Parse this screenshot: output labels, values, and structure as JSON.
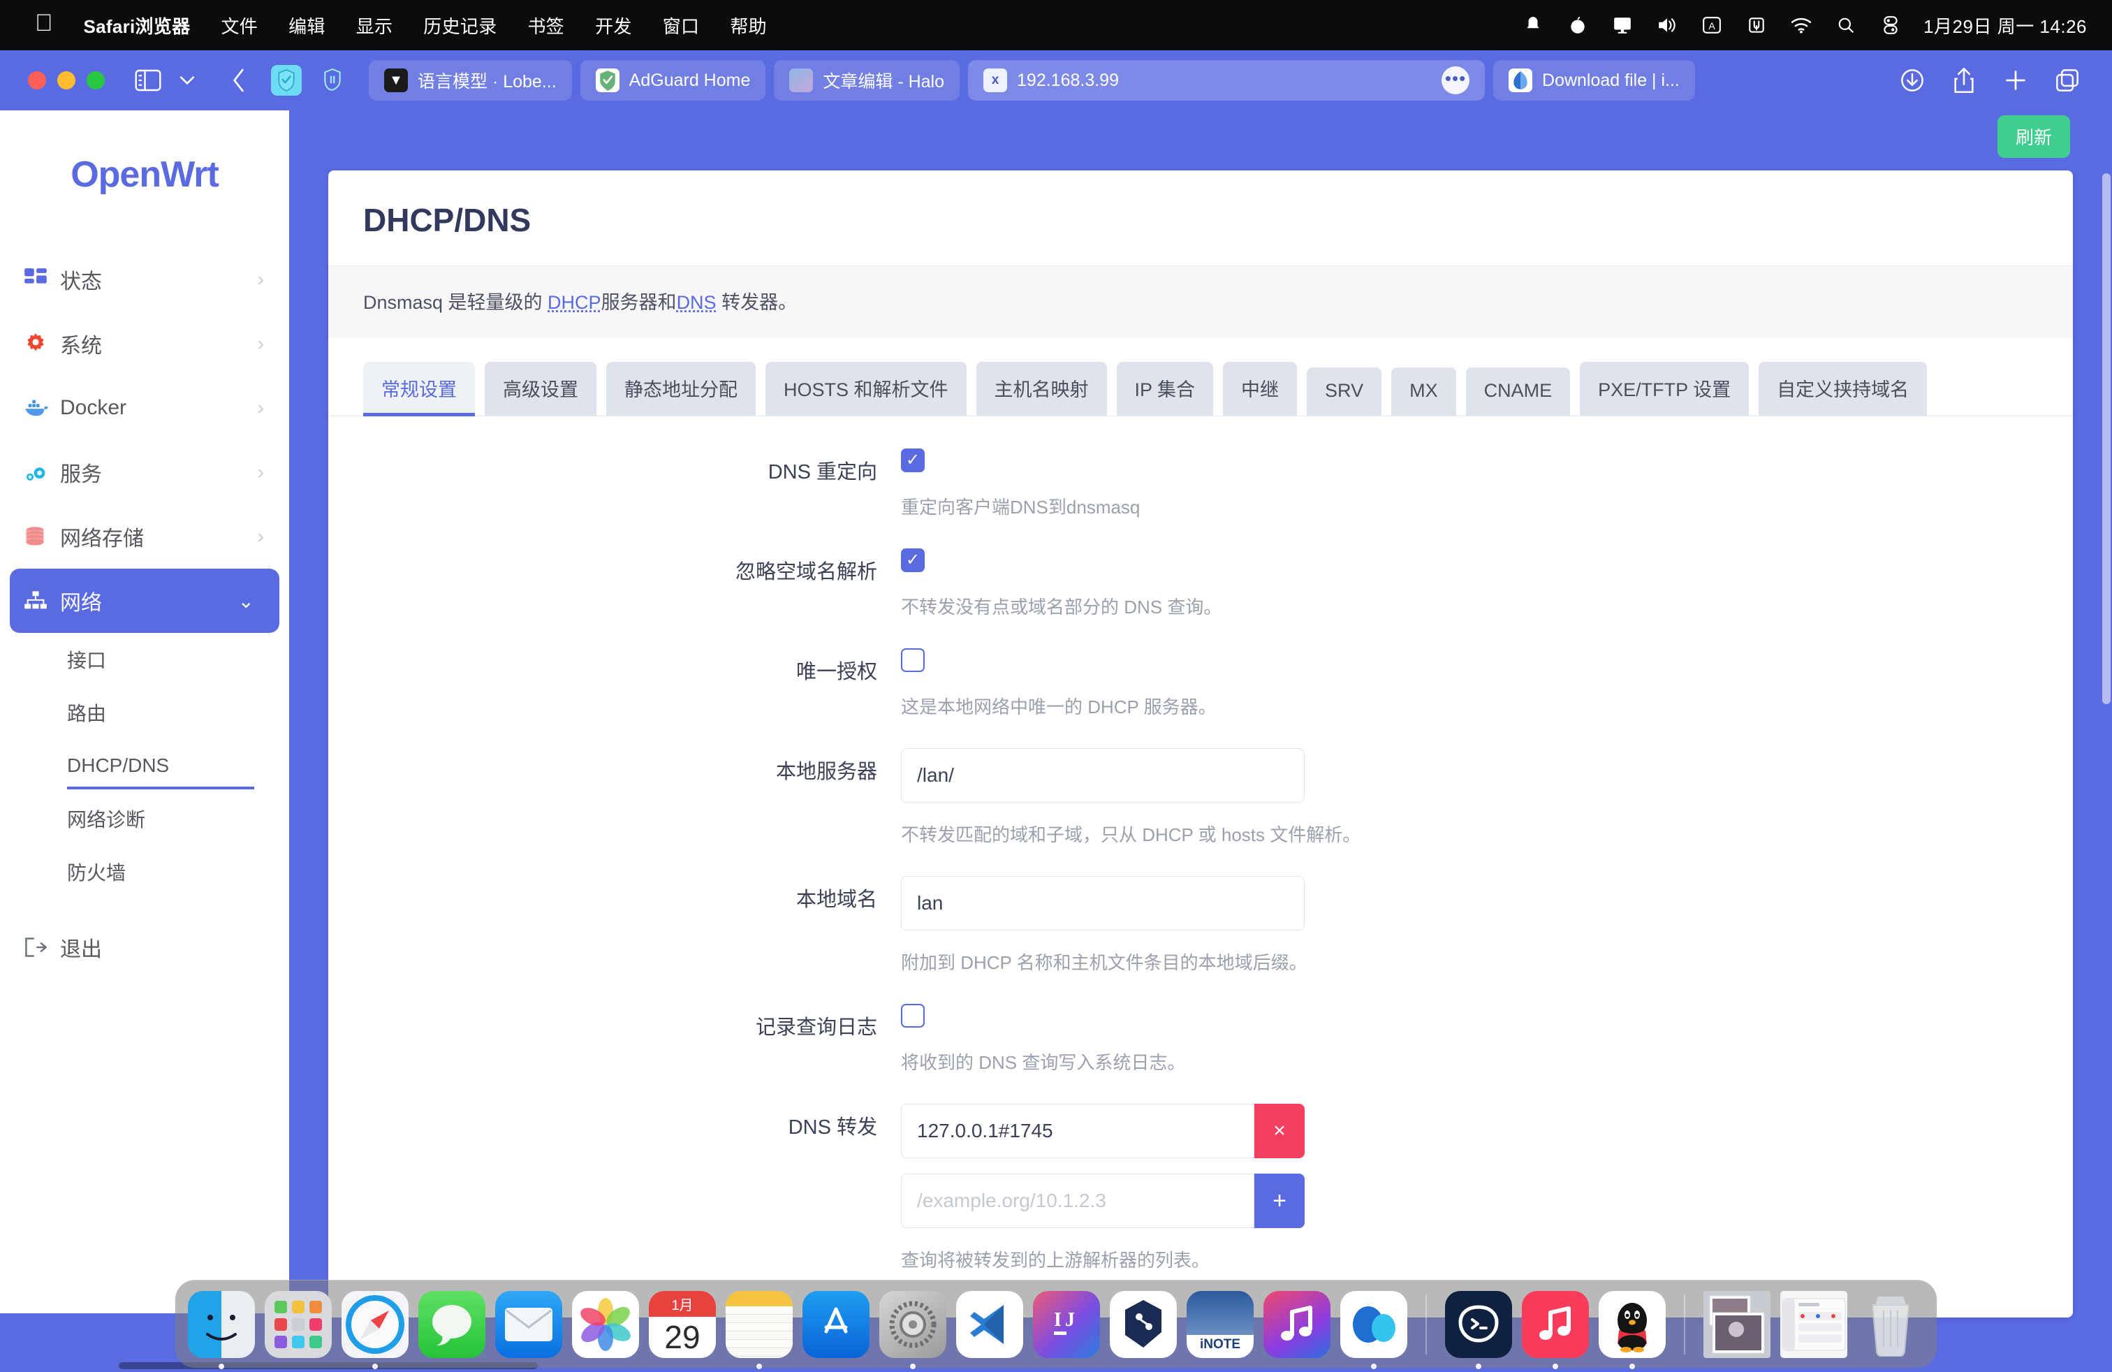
{
  "menubar": {
    "apple_icon": "apple-logo-icon",
    "items": [
      {
        "label": "Safari浏览器",
        "bold": true
      },
      {
        "label": "文件",
        "bold": false
      },
      {
        "label": "编辑",
        "bold": false
      },
      {
        "label": "显示",
        "bold": false
      },
      {
        "label": "历史记录",
        "bold": false
      },
      {
        "label": "书签",
        "bold": false
      },
      {
        "label": "开发",
        "bold": false
      },
      {
        "label": "窗口",
        "bold": false
      },
      {
        "label": "帮助",
        "bold": false
      }
    ],
    "status_icons": [
      "bell-icon",
      "apple-fruit-icon",
      "display-icon",
      "volume-icon",
      "input-source-A-icon",
      "clipboard-icon",
      "wifi-icon",
      "search-icon",
      "control-center-icon"
    ],
    "clock": "1月29日 周一  14:26"
  },
  "safari": {
    "traffic_lights": [
      "close",
      "minimize",
      "zoom"
    ],
    "sidebar_toggle_icon": "sidebar-toggle-icon",
    "tab_overview_chevron_icon": "chevron-down-icon",
    "back_icon": "back-chevron-icon",
    "extension_icons": [
      "adguard-shield-icon",
      "pause-shield-icon"
    ],
    "tabs": [
      {
        "label": "语言模型 · Lobe...",
        "favicon": "lobechat-icon",
        "active": false
      },
      {
        "label": "AdGuard Home",
        "favicon": "adguard-icon",
        "active": false
      },
      {
        "label": "文章编辑 - Halo",
        "favicon": "halo-icon",
        "active": false
      },
      {
        "label": "192.168.3.99",
        "favicon": "x-favicon-icon",
        "active": true,
        "more_icon": "more-dots-icon"
      },
      {
        "label": "Download file | i...",
        "favicon": "download-file-icon",
        "active": false
      }
    ],
    "toolbar_right_icons": [
      "downloads-icon",
      "share-icon",
      "new-tab-icon",
      "tab-overview-icon"
    ]
  },
  "luci": {
    "brand": "OpenWrt",
    "nav": [
      {
        "label": "状态",
        "icon": "dashboard-icon",
        "chevron": "›",
        "active": false
      },
      {
        "label": "系统",
        "icon": "gear-icon",
        "chevron": "›",
        "active": false
      },
      {
        "label": "Docker",
        "icon": "docker-whale-icon",
        "chevron": "›",
        "active": false
      },
      {
        "label": "服务",
        "icon": "cogs-icon",
        "chevron": "›",
        "active": false
      },
      {
        "label": "网络存储",
        "icon": "database-icon",
        "chevron": "›",
        "active": false
      },
      {
        "label": "网络",
        "icon": "network-tree-icon",
        "chevron": "⌄",
        "active": true
      }
    ],
    "subnav": [
      {
        "label": "接口",
        "current": false
      },
      {
        "label": "路由",
        "current": false
      },
      {
        "label": "DHCP/DNS",
        "current": true
      },
      {
        "label": "网络诊断",
        "current": false
      },
      {
        "label": "防火墙",
        "current": false
      }
    ],
    "logout": {
      "label": "退出",
      "icon": "logout-icon"
    }
  },
  "main": {
    "refresh_label": "刷新",
    "page_title": "DHCP/DNS",
    "description_pre": "Dnsmasq 是轻量级的 ",
    "description_link1": "DHCP",
    "description_mid": "服务器和",
    "description_link2": "DNS",
    "description_post": " 转发器。",
    "tabs": [
      {
        "label": "常规设置",
        "active": true
      },
      {
        "label": "高级设置",
        "active": false
      },
      {
        "label": "静态地址分配",
        "active": false
      },
      {
        "label": "HOSTS 和解析文件",
        "active": false
      },
      {
        "label": "主机名映射",
        "active": false
      },
      {
        "label": "IP 集合",
        "active": false
      },
      {
        "label": "中继",
        "active": false
      },
      {
        "label": "SRV",
        "active": false
      },
      {
        "label": "MX",
        "active": false
      },
      {
        "label": "CNAME",
        "active": false
      },
      {
        "label": "PXE/TFTP 设置",
        "active": false
      },
      {
        "label": "自定义挟持域名",
        "active": false
      }
    ],
    "fields": {
      "dns_redirect": {
        "label": "DNS 重定向",
        "checked": true,
        "hint": "重定向客户端DNS到dnsmasq"
      },
      "ignore_empty_domain": {
        "label": "忽略空域名解析",
        "checked": true,
        "hint": "不转发没有点或域名部分的 DNS 查询。"
      },
      "authoritative": {
        "label": "唯一授权",
        "checked": false,
        "hint": "这是本地网络中唯一的 DHCP 服务器。"
      },
      "local_server": {
        "label": "本地服务器",
        "value": "/lan/",
        "hint": "不转发匹配的域和子域，只从 DHCP 或 hosts 文件解析。"
      },
      "local_domain": {
        "label": "本地域名",
        "value": "lan",
        "hint": "附加到 DHCP 名称和主机文件条目的本地域后缀。"
      },
      "log_queries": {
        "label": "记录查询日志",
        "checked": false,
        "hint": "将收到的 DNS 查询写入系统日志。"
      },
      "dns_forwards": {
        "label": "DNS 转发",
        "entries": [
          {
            "value": "127.0.0.1#1745",
            "button": "×",
            "button_kind": "delete"
          }
        ],
        "new_placeholder": "/example.org/10.1.2.3",
        "add_button": "+",
        "hint": "查询将被转发到的上游解析器的列表。"
      }
    }
  },
  "dock": {
    "apps": [
      {
        "name": "finder",
        "running": true
      },
      {
        "name": "launchpad",
        "running": false
      },
      {
        "name": "safari",
        "running": true
      },
      {
        "name": "messages",
        "running": false
      },
      {
        "name": "mail",
        "running": false
      },
      {
        "name": "photos",
        "running": false
      },
      {
        "name": "calendar",
        "label": "1月",
        "day": "29",
        "running": false
      },
      {
        "name": "notes",
        "running": true
      },
      {
        "name": "app-store",
        "running": false
      },
      {
        "name": "system-settings",
        "running": true
      },
      {
        "name": "vscode",
        "running": false
      },
      {
        "name": "intellij-idea",
        "running": false
      },
      {
        "name": "azure-data-studio",
        "running": false
      },
      {
        "name": "inote",
        "label": "iNOTE",
        "running": false
      },
      {
        "name": "music",
        "running": false
      },
      {
        "name": "arc-browser",
        "running": true
      },
      {
        "name": "termius",
        "running": true
      },
      {
        "name": "apple-music",
        "running": true
      },
      {
        "name": "qq",
        "running": true
      }
    ],
    "minimized": [
      {
        "name": "photo-window"
      },
      {
        "name": "finder-window"
      },
      {
        "name": "trash"
      }
    ]
  }
}
